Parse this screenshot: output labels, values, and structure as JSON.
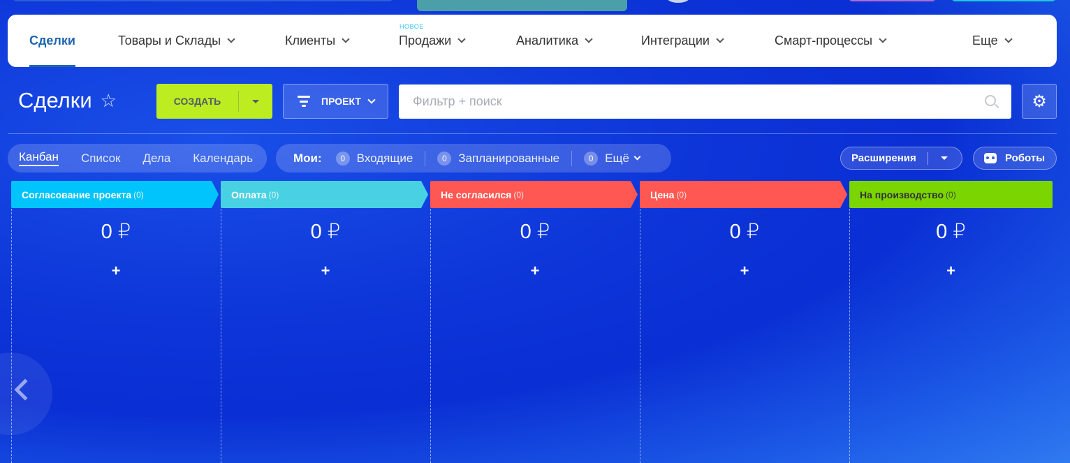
{
  "nav": {
    "items": [
      {
        "label": "Сделки"
      },
      {
        "label": "Товары и Склады"
      },
      {
        "label": "Клиенты"
      },
      {
        "label": "Продажи"
      },
      {
        "label": "Аналитика"
      },
      {
        "label": "Интеграции"
      },
      {
        "label": "Смарт-процессы"
      },
      {
        "label": "Еще"
      }
    ],
    "badge": "НОВОЕ"
  },
  "title": "Сделки",
  "toolbar": {
    "create_label": "СОЗДАТЬ",
    "project_label": "ПРОЕКТ",
    "search_placeholder": "Фильтр + поиск"
  },
  "views": [
    "Канбан",
    "Список",
    "Дела",
    "Календарь"
  ],
  "counters": {
    "mine_label": "Мои:",
    "items": [
      {
        "count": "0",
        "label": "Входящие"
      },
      {
        "count": "0",
        "label": "Запланированные"
      },
      {
        "count": "0",
        "label": "Ещё"
      }
    ]
  },
  "extensions_label": "Расширения",
  "robots_label": "Роботы",
  "columns": [
    {
      "title": "Согласование проекта",
      "count": "(0)",
      "sum": "0 ₽",
      "color": "#00c4fb"
    },
    {
      "title": "Оплата",
      "count": "(0)",
      "sum": "0 ₽",
      "color": "#47d1e2"
    },
    {
      "title": "Не согласился",
      "count": "(0)",
      "sum": "0 ₽",
      "color": "#ff5752"
    },
    {
      "title": "Цена",
      "count": "(0)",
      "sum": "0 ₽",
      "color": "#ff5752"
    },
    {
      "title": "На производство",
      "count": "(0)",
      "sum": "0 ₽",
      "color": "#7bd500"
    }
  ],
  "plus": "+"
}
